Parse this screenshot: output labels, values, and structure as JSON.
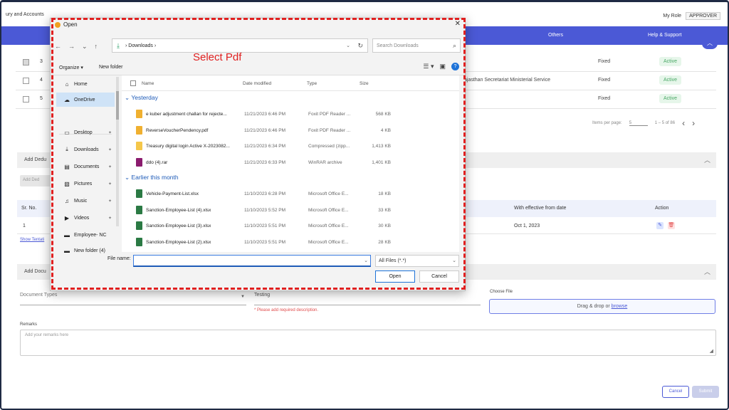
{
  "app": {
    "title": "ury and Accounts",
    "role_label": "My Role",
    "role_value": "APPROVER"
  },
  "navbar": {
    "others": "Others",
    "help": "Help & Support"
  },
  "bg_table": {
    "rows": [
      {
        "num": "3",
        "service": "",
        "type": "Fixed",
        "status": "Active",
        "checked": true
      },
      {
        "num": "4",
        "service": "ajasthan Secretariat Ministerial Service",
        "type": "Fixed",
        "status": "Active",
        "checked": false
      },
      {
        "num": "5",
        "service": "",
        "type": "Fixed",
        "status": "Active",
        "checked": false
      }
    ],
    "pager": {
      "items_per_page": "Items per page:",
      "per_page_value": "5",
      "range": "1 – 5 of 86"
    }
  },
  "sections": {
    "add_deduction": "Add Dedu",
    "add_button": "Add Ded",
    "add_document": "Add Docu"
  },
  "deduction_table": {
    "headers": {
      "srno": "Sr. No.",
      "effective": "With effective from date",
      "action": "Action"
    },
    "row": {
      "srno": "1",
      "effective": "Oct 1, 2023"
    },
    "show_link": "Show Tentati"
  },
  "document_form": {
    "doc_type_placeholder": "Document Types",
    "description_value": "Testing",
    "description_error": "* Please add required description.",
    "choose_file_label": "Choose File",
    "drop_text": "Drag & drop or ",
    "browse_text": "browse",
    "remarks_label": "Remarks",
    "remarks_placeholder": "Add your remarks here",
    "cancel_label": "Cancel",
    "submit_label": "Submit"
  },
  "dialog": {
    "title": "Open",
    "address": "Downloads",
    "search_placeholder": "Search Downloads",
    "organize": "Organize",
    "new_folder": "New folder",
    "annotation": "Select Pdf",
    "sidebar": [
      {
        "label": "Home",
        "icon": "home-icon",
        "glyph": "⌂",
        "pinned": false,
        "active": false
      },
      {
        "label": "OneDrive",
        "icon": "cloud-icon",
        "glyph": "☁",
        "pinned": false,
        "active": true
      },
      {
        "label": "Desktop",
        "icon": "desktop-icon",
        "glyph": "▭",
        "pinned": true,
        "active": false
      },
      {
        "label": "Downloads",
        "icon": "download-icon",
        "glyph": "⤓",
        "pinned": true,
        "active": false
      },
      {
        "label": "Documents",
        "icon": "document-icon",
        "glyph": "▤",
        "pinned": true,
        "active": false
      },
      {
        "label": "Pictures",
        "icon": "picture-icon",
        "glyph": "▧",
        "pinned": true,
        "active": false
      },
      {
        "label": "Music",
        "icon": "music-icon",
        "glyph": "♫",
        "pinned": true,
        "active": false
      },
      {
        "label": "Videos",
        "icon": "video-icon",
        "glyph": "▶",
        "pinned": true,
        "active": false
      },
      {
        "label": "Employee- NC",
        "icon": "folder-icon",
        "glyph": "▬",
        "pinned": false,
        "active": false
      },
      {
        "label": "New folder (4)",
        "icon": "folder-icon",
        "glyph": "▬",
        "pinned": false,
        "active": false
      }
    ],
    "columns": {
      "name": "Name",
      "date": "Date modified",
      "type": "Type",
      "size": "Size"
    },
    "groups": [
      {
        "label": "Yesterday",
        "files": [
          {
            "name": "e kuber adjustment challan for rejecte...",
            "date": "11/21/2023 6:46 PM",
            "type": "Foxit PDF Reader ...",
            "size": "568 KB",
            "kind": "pdf"
          },
          {
            "name": "ReverseVoucherPendency.pdf",
            "date": "11/21/2023 6:46 PM",
            "type": "Foxit PDF Reader ...",
            "size": "4 KB",
            "kind": "pdf"
          },
          {
            "name": "Treasury digital login Active X-2023082...",
            "date": "11/21/2023 6:34 PM",
            "type": "Compressed (zipp...",
            "size": "1,413 KB",
            "kind": "zip"
          },
          {
            "name": "ddo (4).rar",
            "date": "11/21/2023 6:33 PM",
            "type": "WinRAR archive",
            "size": "1,401 KB",
            "kind": "rar"
          }
        ]
      },
      {
        "label": "Earlier this month",
        "files": [
          {
            "name": "Vehicle-Payment-List.xlsx",
            "date": "11/10/2023 6:28 PM",
            "type": "Microsoft Office E...",
            "size": "18 KB",
            "kind": "xls"
          },
          {
            "name": "Sanction-Employee-List (4).xlsx",
            "date": "11/10/2023 5:52 PM",
            "type": "Microsoft Office E...",
            "size": "33 KB",
            "kind": "xls"
          },
          {
            "name": "Sanction-Employee-List (3).xlsx",
            "date": "11/10/2023 5:51 PM",
            "type": "Microsoft Office E...",
            "size": "30 KB",
            "kind": "xls"
          },
          {
            "name": "Sanction-Employee-List (2).xlsx",
            "date": "11/10/2023 5:51 PM",
            "type": "Microsoft Office E...",
            "size": "28 KB",
            "kind": "xls"
          }
        ]
      }
    ],
    "file_name_label": "File name:",
    "file_name_value": "",
    "file_type": "All Files (*.*)",
    "open_label": "Open",
    "cancel_label": "Cancel"
  },
  "colors": {
    "accent": "#4b59d6",
    "annotation": "#e02020",
    "active_badge": "#4aa866"
  }
}
